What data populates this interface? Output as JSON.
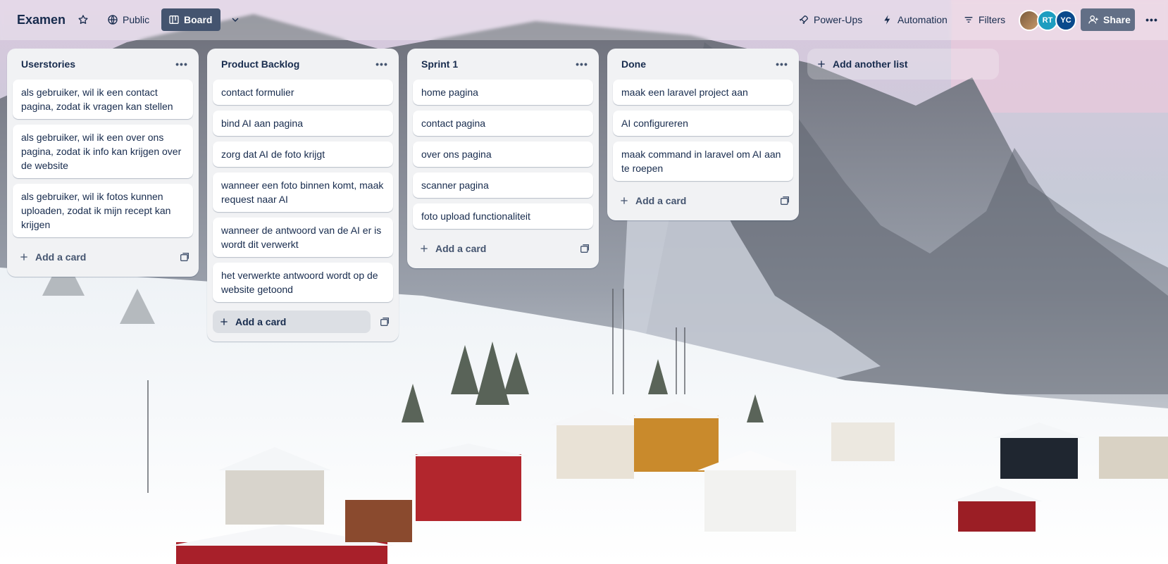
{
  "header": {
    "board_title": "Examen",
    "visibility_label": "Public",
    "view_label": "Board",
    "powerups_label": "Power-Ups",
    "automation_label": "Automation",
    "filters_label": "Filters",
    "share_label": "Share",
    "members": [
      {
        "initials": ""
      },
      {
        "initials": "RT"
      },
      {
        "initials": "YC"
      }
    ]
  },
  "lists": [
    {
      "title": "Userstories",
      "cards": [
        "als gebruiker, wil ik een contact pagina, zodat ik vragen kan stellen",
        "als gebruiker, wil ik een over ons pagina, zodat ik info kan krijgen over de website",
        "als gebruiker, wil ik fotos kunnen uploaden, zodat ik mijn recept kan krijgen"
      ],
      "add_card_label": "Add a card"
    },
    {
      "title": "Product Backlog",
      "cards": [
        "contact formulier",
        "bind AI aan pagina",
        "zorg dat AI de foto krijgt",
        "wanneer een foto binnen komt, maak request naar AI",
        "wanneer de antwoord van de AI er is wordt dit verwerkt",
        "het verwerkte antwoord wordt op de website getoond"
      ],
      "add_card_label": "Add a card"
    },
    {
      "title": "Sprint 1",
      "cards": [
        "home pagina",
        "contact pagina",
        "over ons pagina",
        "scanner pagina",
        "foto upload functionaliteit"
      ],
      "add_card_label": "Add a card"
    },
    {
      "title": "Done",
      "cards": [
        "maak een laravel project aan",
        "AI configureren",
        "maak command in laravel om AI aan te roepen"
      ],
      "add_card_label": "Add a card"
    }
  ],
  "add_list_label": "Add another list",
  "colors": {
    "list_bg": "#f1f2f4",
    "card_bg": "#ffffff",
    "text": "#172b4d",
    "board_button_bg": "#44546f",
    "share_button_bg": "#626f86"
  }
}
